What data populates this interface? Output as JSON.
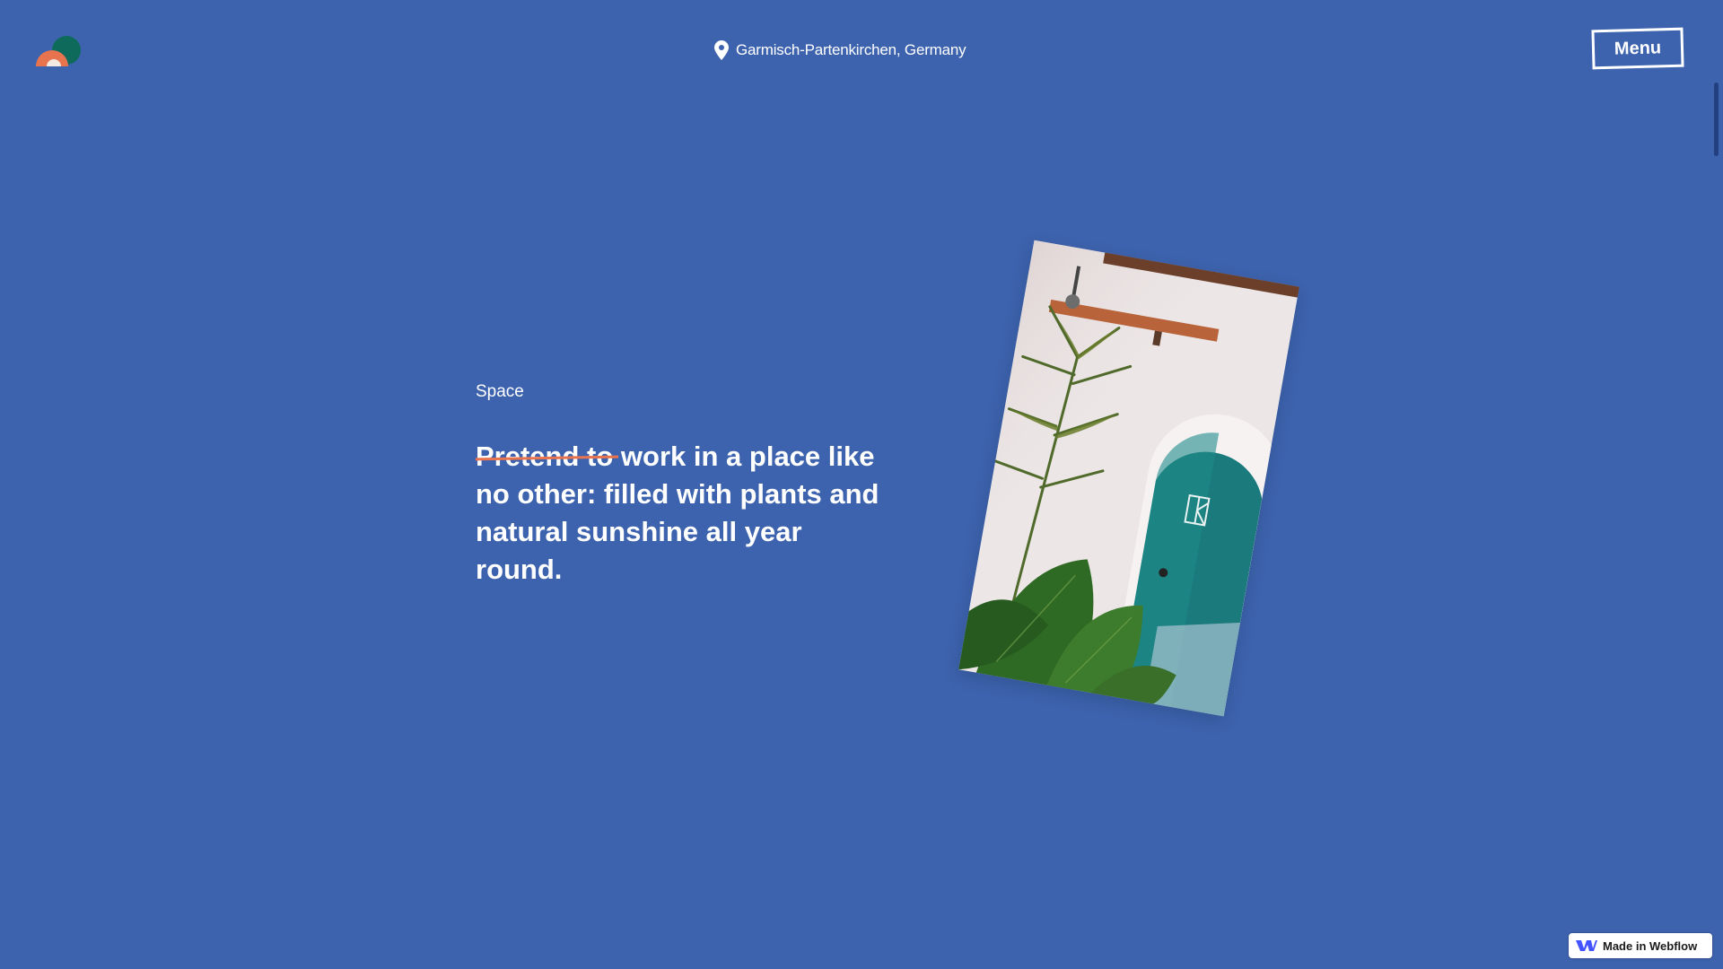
{
  "header": {
    "logo_icon": "brand-circles-logo",
    "location_icon": "map-pin-icon",
    "location_text": "Garmisch-Partenkirchen, Germany",
    "menu_label": "Menu"
  },
  "content": {
    "section_label": "Space",
    "headline_struck": "Pretend to",
    "headline_rest": " work in a place like no other: filled with plants and natural sunshine all year round."
  },
  "badge": {
    "label": "Made in Webflow",
    "icon": "webflow-logo-icon"
  },
  "colors": {
    "background": "#3d63ae",
    "strike": "#e8744f",
    "logo_green": "#0e6b5c",
    "logo_orange": "#e8744f",
    "door_teal": "#1a7a7c"
  }
}
